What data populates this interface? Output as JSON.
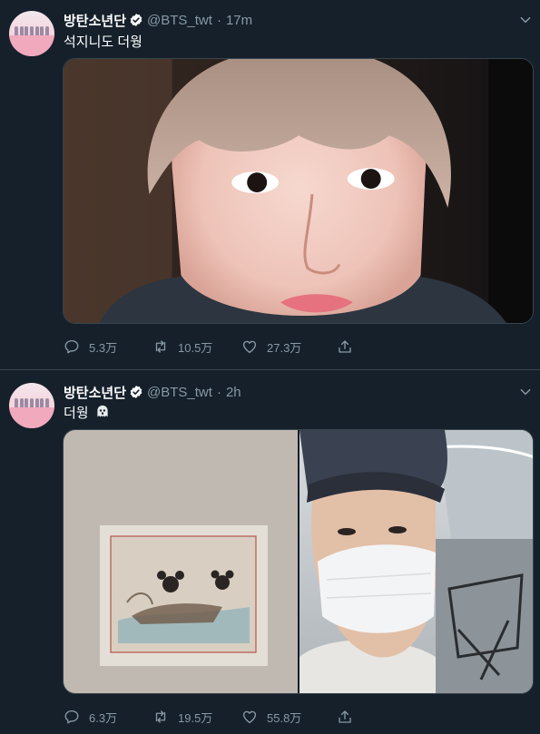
{
  "tweets": [
    {
      "name": "방탄소년단",
      "handle": "@BTS_twt",
      "separator": "·",
      "time": "17m",
      "text": "석지니도 더웡",
      "replies": "5.3万",
      "retweets": "10.5万",
      "likes": "27.3万"
    },
    {
      "name": "방탄소년단",
      "handle": "@BTS_twt",
      "separator": "·",
      "time": "2h",
      "text": "더웡",
      "replies": "6.3万",
      "retweets": "19.5万",
      "likes": "55.8万"
    }
  ],
  "colors": {
    "background": "#15202b",
    "secondary_text": "#8899a6",
    "verified": "#ffffff",
    "divider": "#38444d"
  },
  "icons": [
    "verified-badge-icon",
    "chevron-down-icon",
    "reply-icon",
    "retweet-icon",
    "like-icon",
    "share-icon",
    "ghost-emoji-icon"
  ]
}
